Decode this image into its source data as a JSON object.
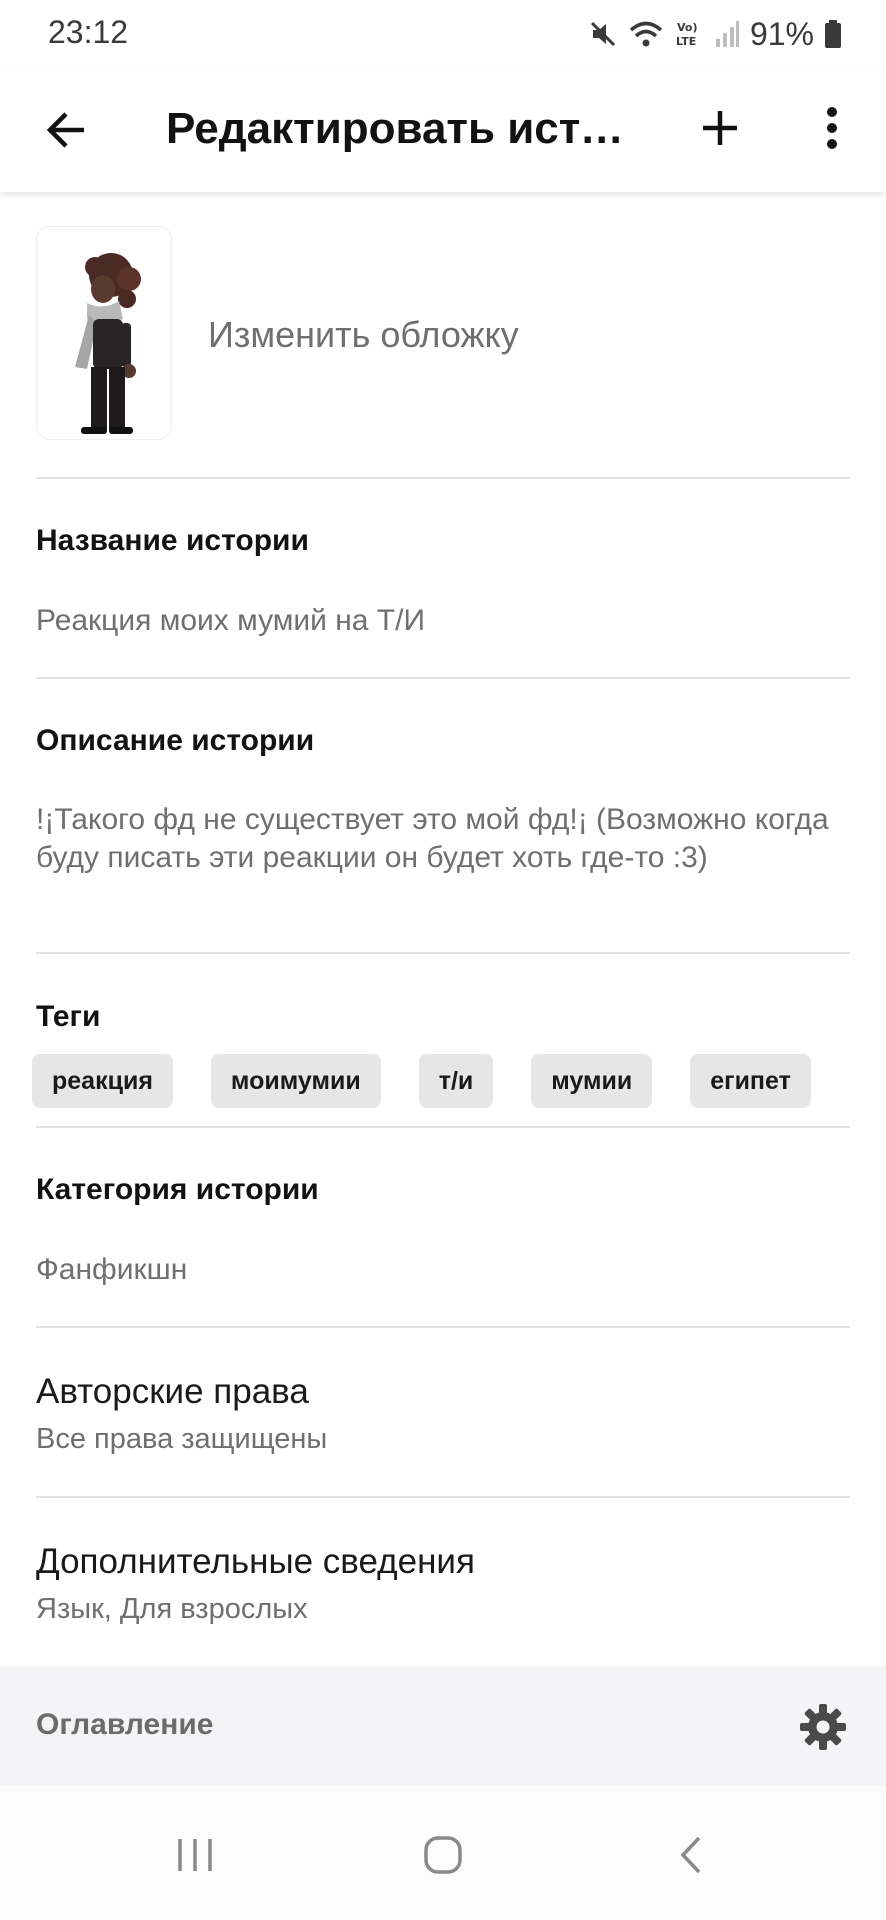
{
  "status_bar": {
    "time": "23:12",
    "battery": "91%",
    "icons": [
      "mute-icon",
      "wifi-icon",
      "volte-icon",
      "signal-icon",
      "battery-icon"
    ]
  },
  "top_bar": {
    "title": "Редактировать история",
    "back_icon": "arrow-left-icon",
    "add_icon": "plus-icon",
    "more_icon": "more-vertical-icon"
  },
  "cover": {
    "action_label": "Изменить обложку"
  },
  "story_title": {
    "label": "Название истории",
    "value": "Реакция моих мумий на Т/И"
  },
  "story_description": {
    "label": "Описание истории",
    "value": "!¡Такого фд не существует это мой фд!¡ (Возможно когда буду писать эти реакции он будет хоть где-то :3)"
  },
  "tags": {
    "label": "Теги",
    "items": [
      "реакция",
      "моимумии",
      "т/и",
      "мумии",
      "египет"
    ]
  },
  "category": {
    "label": "Категория истории",
    "value": "Фанфикшн"
  },
  "copyright": {
    "title": "Авторские права",
    "value": "Все права защищены"
  },
  "additional": {
    "title": "Дополнительные сведения",
    "value": "Язык, Для взрослых"
  },
  "toc": {
    "label": "Оглавление",
    "icon": "gear-icon"
  },
  "nav_bar": {
    "icons": [
      "recent-apps-icon",
      "home-icon",
      "back-icon"
    ]
  },
  "colors": {
    "text_primary": "#121212",
    "text_secondary": "#6f6f6f",
    "divider": "#e2e2e2",
    "tag_bg": "#e6e6e6",
    "toc_bg": "#f4f4f6"
  }
}
